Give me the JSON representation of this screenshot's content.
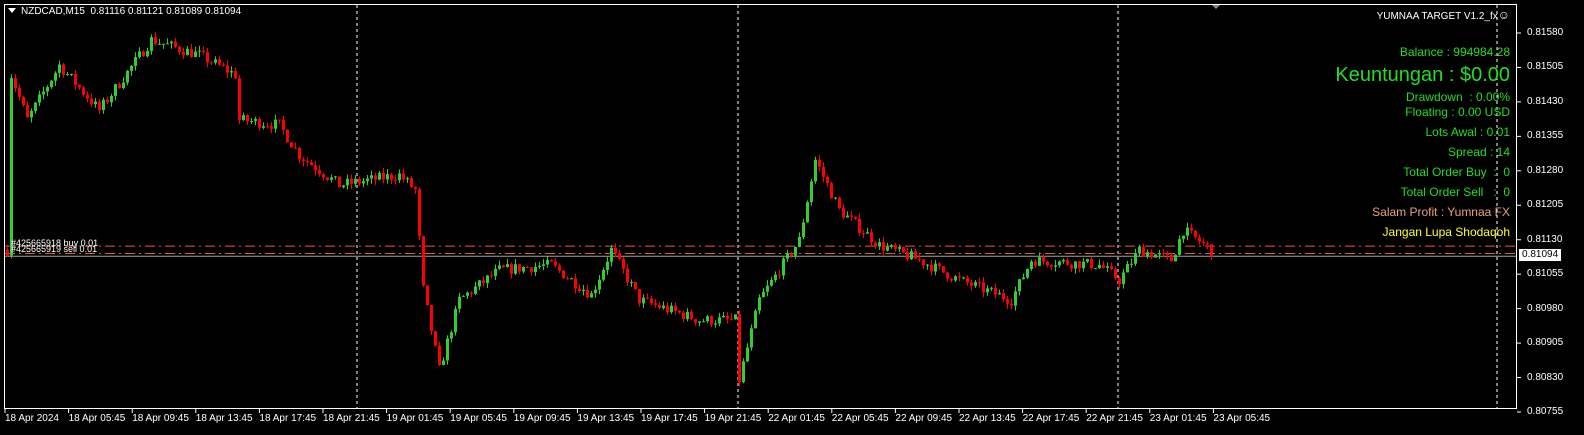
{
  "header": {
    "symbol": "NZDCAD,M15",
    "ohlc": "0.81116 0.81121 0.81089 0.81094"
  },
  "ea_panel": {
    "title": "YUMNAA TARGET V1.2_fx",
    "title_icon": "smiley-icon",
    "balance": "Balance : 994984.28",
    "profit": "Keuntungan : $0.00",
    "drawdown": "Drawdown  : 0.00%",
    "floating": "Floating : 0.00 USD",
    "lots": "Lots Awal : 0.01",
    "spread": "Spread : 14",
    "total_buy": "Total Order Buy  :  0",
    "total_sell": "Total Order Sell   :  0",
    "salam": "Salam Profit : Yumnaa FX",
    "shodaqoh": "Jangan Lupa Shodaqoh",
    "colors": {
      "green": "#22dd22",
      "salam": "#e8a080",
      "shodaqoh": "#ffff33"
    }
  },
  "orders": [
    {
      "label": "#425665918 buy 0.01",
      "price": 0.81116
    },
    {
      "label": "#425665919 sell 0.01",
      "price": 0.811
    }
  ],
  "current_price": "0.81094",
  "price_axis": [
    "0.81580",
    "0.81505",
    "0.81430",
    "0.81355",
    "0.81280",
    "0.81205",
    "0.81130",
    "0.81055",
    "0.80980",
    "0.80905",
    "0.80830",
    "0.80755"
  ],
  "time_axis": [
    "18 Apr 2024",
    "18 Apr 05:45",
    "18 Apr 09:45",
    "18 Apr 13:45",
    "18 Apr 17:45",
    "18 Apr 21:45",
    "19 Apr 01:45",
    "19 Apr 05:45",
    "19 Apr 09:45",
    "19 Apr 13:45",
    "19 Apr 17:45",
    "19 Apr 21:45",
    "22 Apr 01:45",
    "22 Apr 05:45",
    "22 Apr 09:45",
    "22 Apr 13:45",
    "22 Apr 17:45",
    "22 Apr 21:45",
    "23 Apr 01:45",
    "23 Apr 05:45"
  ],
  "chart_data": {
    "type": "candlestick",
    "timeframe": "M15",
    "ylim": [
      0.80755,
      0.8158
    ],
    "bull_color": "#32cd32",
    "bear_color": "#ff0000",
    "order_line_color": "#e05a2a",
    "approx_close_path": [
      [
        1,
        0.81489
      ],
      [
        5,
        0.81391
      ],
      [
        13,
        0.8151
      ],
      [
        23,
        0.81412
      ],
      [
        36,
        0.81565
      ],
      [
        48,
        0.81532
      ],
      [
        57,
        0.81489
      ],
      [
        58,
        0.81391
      ],
      [
        68,
        0.8138
      ],
      [
        73,
        0.81314
      ],
      [
        83,
        0.81249
      ],
      [
        98,
        0.81271
      ],
      [
        102,
        0.81238
      ],
      [
        104,
        0.81021
      ],
      [
        108,
        0.80846
      ],
      [
        113,
        0.80999
      ],
      [
        123,
        0.81064
      ],
      [
        136,
        0.81075
      ],
      [
        146,
        0.8101
      ],
      [
        151,
        0.81108
      ],
      [
        158,
        0.80999
      ],
      [
        173,
        0.80955
      ],
      [
        182,
        0.80955
      ],
      [
        183,
        0.80825
      ],
      [
        188,
        0.80999
      ],
      [
        198,
        0.81129
      ],
      [
        202,
        0.81304
      ],
      [
        208,
        0.81195
      ],
      [
        218,
        0.81118
      ],
      [
        228,
        0.81086
      ],
      [
        238,
        0.81042
      ],
      [
        251,
        0.80999
      ],
      [
        256,
        0.81086
      ],
      [
        273,
        0.81075
      ],
      [
        278,
        0.81042
      ],
      [
        283,
        0.81108
      ],
      [
        291,
        0.81086
      ],
      [
        294,
        0.81151
      ],
      [
        301,
        0.81108
      ]
    ]
  }
}
